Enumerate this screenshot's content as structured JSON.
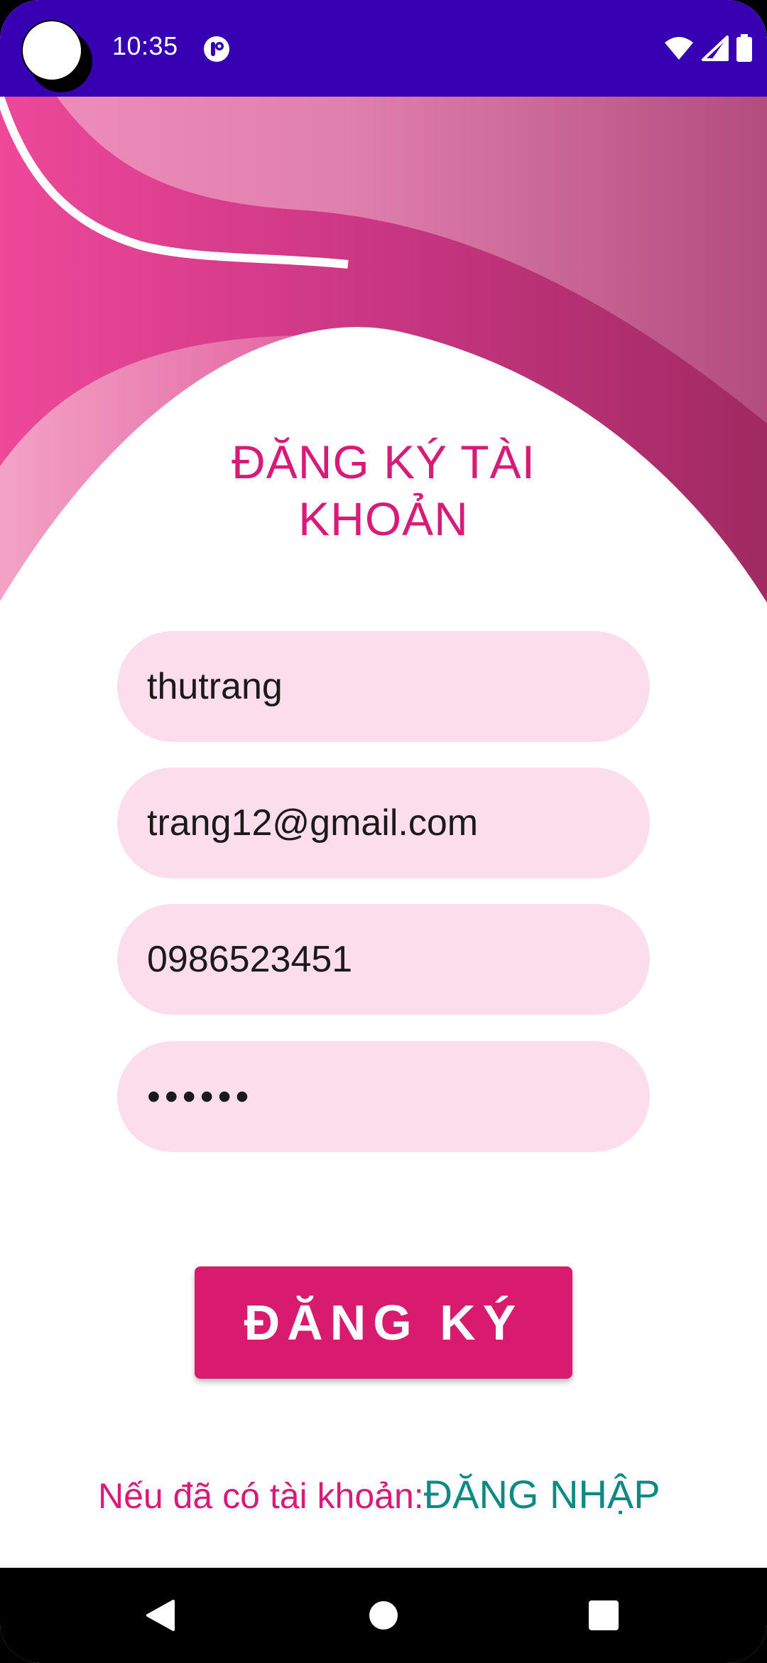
{
  "status_bar": {
    "time": "10:35",
    "icons": [
      "camera-cutout",
      "app-notification-icon",
      "wifi-icon",
      "signal-icon",
      "battery-icon"
    ],
    "background": "#3700B3"
  },
  "page": {
    "title": "ĐĂNG KÝ TÀI KHOẢN",
    "title_color": "#D81B79"
  },
  "form": {
    "username": "thutrang",
    "email": "trang12@gmail.com",
    "phone": "0986523451",
    "password": "••••••",
    "field_background": "#FCDDEB"
  },
  "register_button": {
    "label": "ĐĂNG KÝ",
    "color": "#D81B6E"
  },
  "login": {
    "prompt": "Nếu đã có tài khoản:",
    "link": "ĐĂNG NHẬP",
    "prompt_color": "#D81B79",
    "link_color": "#0E8A86"
  },
  "nav_bar": {
    "buttons": [
      "back-icon",
      "home-icon",
      "recents-icon"
    ]
  }
}
